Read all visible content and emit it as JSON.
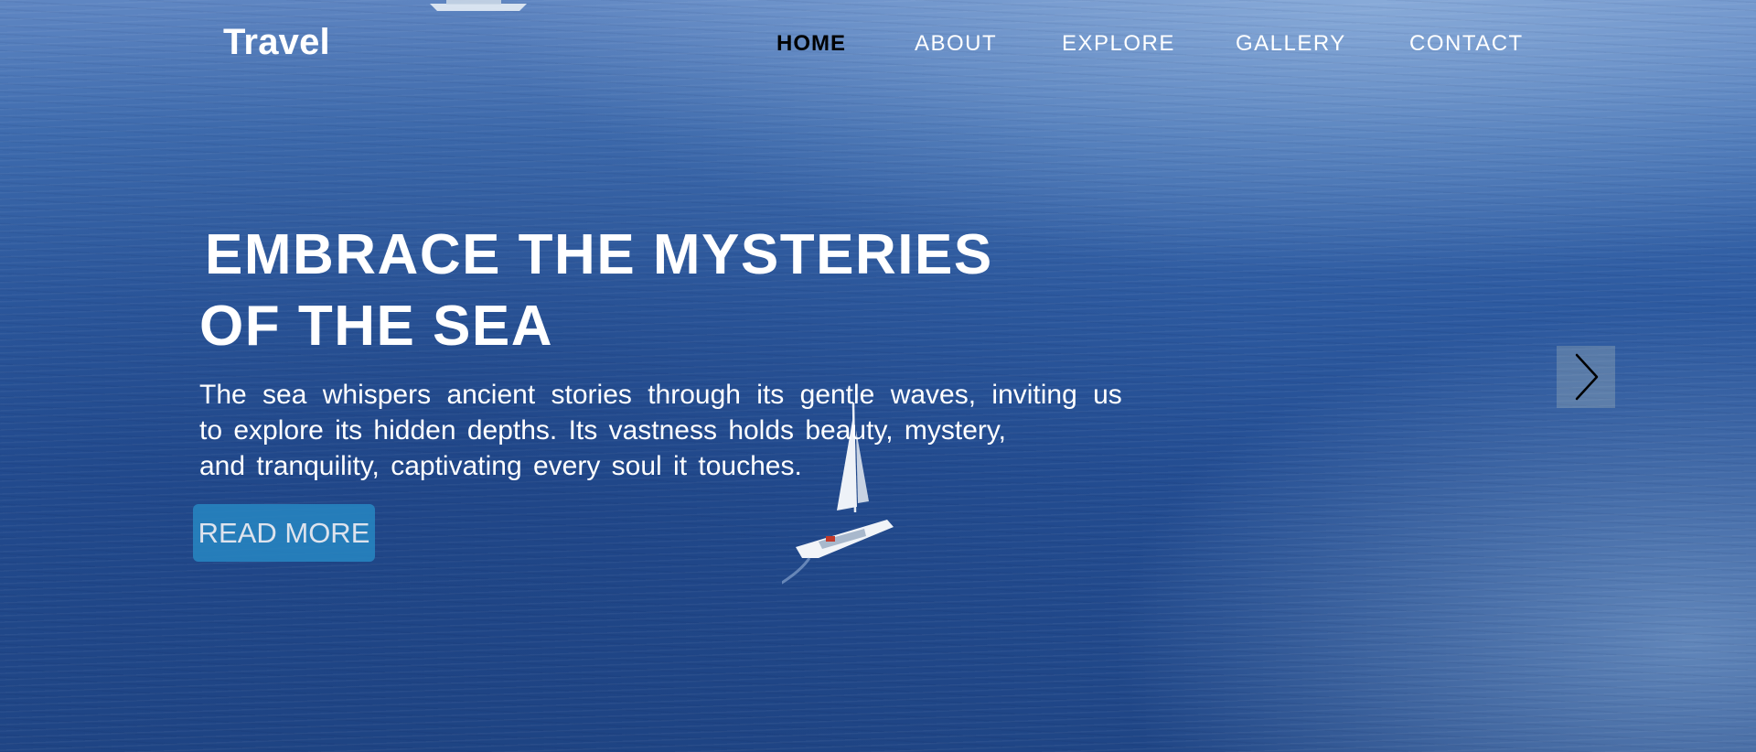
{
  "brand": {
    "logo": "Travel"
  },
  "nav": {
    "items": [
      {
        "label": "HOME",
        "active": true
      },
      {
        "label": "ABOUT",
        "active": false
      },
      {
        "label": "EXPLORE",
        "active": false
      },
      {
        "label": "GALLERY",
        "active": false
      },
      {
        "label": "CONTACT",
        "active": false
      }
    ]
  },
  "hero": {
    "headline_lines": [
      "EMBRACE THE MYSTERIES",
      "OF THE SEA"
    ],
    "description_lines": [
      "The sea whispers ancient stories through its gentle waves, inviting us",
      "to explore its hidden depths. Its vastness holds beauty, mystery,",
      "and tranquility, captivating every soul it touches."
    ],
    "cta_label": "READ MORE"
  },
  "icons": {
    "next": "chevron-right-icon"
  },
  "colors": {
    "active_nav": "#000000",
    "text": "#ffffff",
    "cta_background": "#2787c3",
    "sea": "#2d5aa0"
  }
}
